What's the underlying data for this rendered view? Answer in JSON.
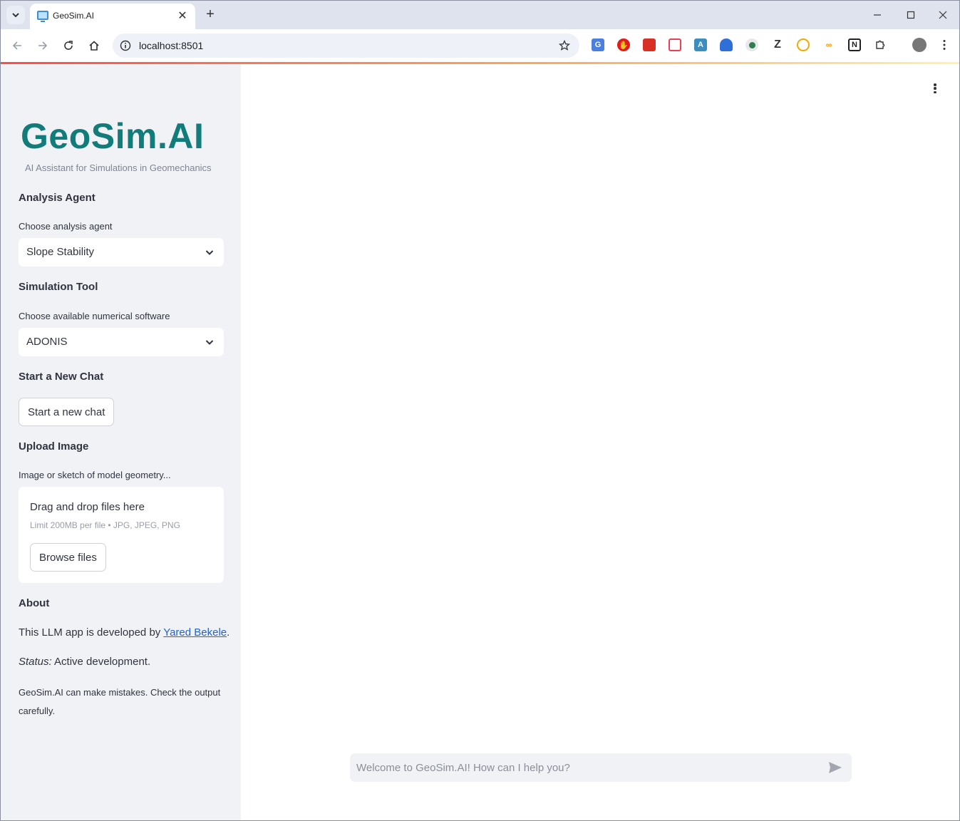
{
  "browser": {
    "tab_title": "GeoSim.AI",
    "url": "localhost:8501"
  },
  "app": {
    "logo_text": "GeoSim.AI",
    "tagline": "AI Assistant for Simulations in Geomechanics",
    "accent_color": "#127c7a"
  },
  "sidebar": {
    "analysis": {
      "heading": "Analysis Agent",
      "label": "Choose analysis agent",
      "selected": "Slope Stability"
    },
    "simulation": {
      "heading": "Simulation Tool",
      "label": "Choose available numerical software",
      "selected": "ADONIS"
    },
    "new_chat": {
      "heading": "Start a New Chat",
      "button_label": "Start a new chat"
    },
    "upload": {
      "heading": "Upload Image",
      "label": "Image or sketch of model geometry...",
      "drop_text": "Drag and drop files here",
      "limit_text": "Limit 200MB per file • JPG, JPEG, PNG",
      "browse_label": "Browse files"
    },
    "about": {
      "heading": "About",
      "developed_prefix": "This LLM app is developed by ",
      "developer_name": "Yared Bekele",
      "developed_suffix": ".",
      "status_label": "Status:",
      "status_value": " Active development.",
      "disclaimer": "GeoSim.AI can make mistakes. Check the output carefully."
    }
  },
  "chat": {
    "placeholder": "Welcome to GeoSim.AI! How can I help you?"
  }
}
